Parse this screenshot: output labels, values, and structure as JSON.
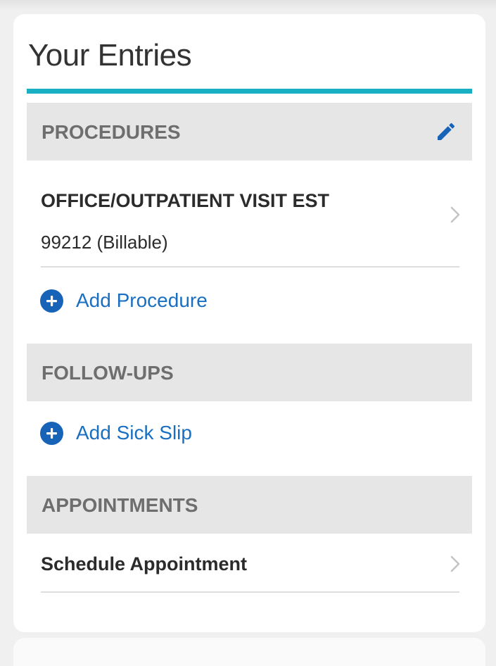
{
  "card": {
    "title": "Your Entries"
  },
  "colors": {
    "accent": "#1ab0c4",
    "link": "#1a6fc0",
    "section_bg": "#e6e6e6"
  },
  "procedures": {
    "header": "PROCEDURES",
    "edit_icon": "pencil-icon",
    "items": [
      {
        "title": "OFFICE/OUTPATIENT VISIT EST",
        "code": "99212 (Billable)"
      }
    ],
    "add_label": "Add Procedure"
  },
  "follow_ups": {
    "header": "FOLLOW-UPS",
    "add_label": "Add Sick Slip"
  },
  "appointments": {
    "header": "APPOINTMENTS",
    "items": [
      {
        "title": "Schedule Appointment"
      }
    ]
  }
}
